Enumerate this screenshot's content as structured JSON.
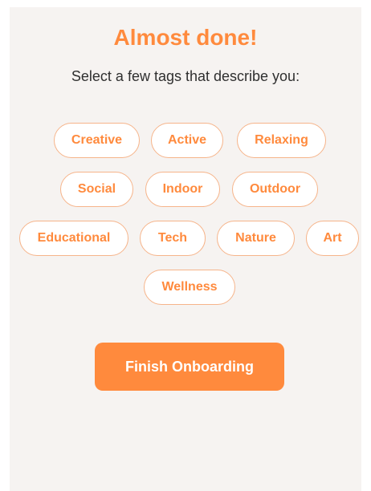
{
  "header": {
    "title": "Almost done!",
    "subtitle": "Select a few tags that describe you:"
  },
  "tags": [
    {
      "label": "Creative"
    },
    {
      "label": "Active"
    },
    {
      "label": "Relaxing"
    },
    {
      "label": "Social"
    },
    {
      "label": "Indoor"
    },
    {
      "label": "Outdoor"
    },
    {
      "label": "Educational"
    },
    {
      "label": "Tech"
    },
    {
      "label": "Nature"
    },
    {
      "label": "Art"
    },
    {
      "label": "Wellness"
    }
  ],
  "actions": {
    "finish_label": "Finish Onboarding"
  },
  "colors": {
    "accent": "#ff8a3d",
    "tag_border": "#f6b48a",
    "background": "#f6f3f1",
    "text": "#2f2f2f"
  }
}
